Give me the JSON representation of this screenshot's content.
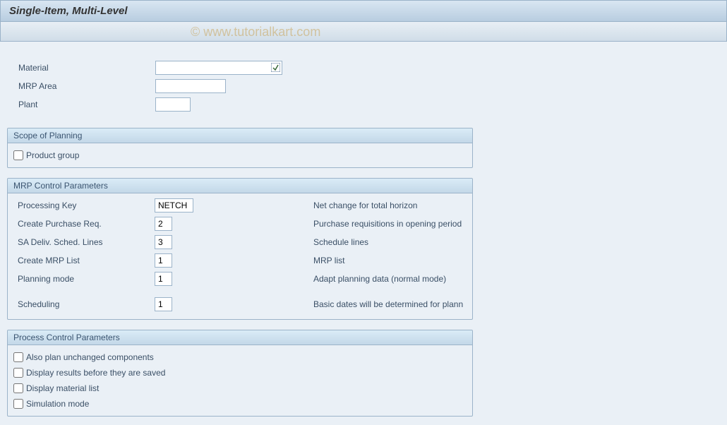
{
  "header": {
    "title": "Single-Item, Multi-Level"
  },
  "watermark": "© www.tutorialkart.com",
  "topFields": {
    "material": {
      "label": "Material",
      "value": ""
    },
    "mrpArea": {
      "label": "MRP Area",
      "value": ""
    },
    "plant": {
      "label": "Plant",
      "value": ""
    }
  },
  "scopeOfPlanning": {
    "title": "Scope of Planning",
    "productGroup": {
      "label": "Product group",
      "checked": false
    }
  },
  "mrpControl": {
    "title": "MRP Control Parameters",
    "processingKey": {
      "label": "Processing Key",
      "value": "NETCH",
      "desc": "Net change for total horizon"
    },
    "createPurchaseReq": {
      "label": "Create Purchase Req.",
      "value": "2",
      "desc": "Purchase requisitions in opening period"
    },
    "saDelivSchedLines": {
      "label": "SA Deliv. Sched. Lines",
      "value": "3",
      "desc": "Schedule lines"
    },
    "createMrpList": {
      "label": "Create MRP List",
      "value": "1",
      "desc": "MRP list"
    },
    "planningMode": {
      "label": "Planning mode",
      "value": "1",
      "desc": "Adapt planning data (normal mode)"
    },
    "scheduling": {
      "label": "Scheduling",
      "value": "1",
      "desc": "Basic dates will be determined for plann"
    }
  },
  "processControl": {
    "title": "Process Control Parameters",
    "alsoPlanUnchanged": {
      "label": "Also plan unchanged components",
      "checked": false
    },
    "displayResultsBeforeSave": {
      "label": "Display results before they are saved",
      "checked": false
    },
    "displayMaterialList": {
      "label": "Display material list",
      "checked": false
    },
    "simulationMode": {
      "label": "Simulation mode",
      "checked": false
    }
  }
}
